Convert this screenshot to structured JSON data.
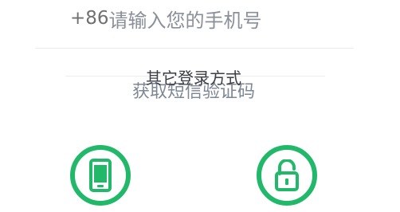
{
  "phone": {
    "country_code": "+86",
    "placeholder": "请输入您的手机号"
  },
  "other_login": {
    "label": "其它登录方式"
  },
  "sms_code": {
    "label": "获取短信验证码"
  },
  "options": [
    {
      "icon": "mobile-phone-icon"
    },
    {
      "icon": "unlock-icon"
    }
  ],
  "colors": {
    "accent": "#22b86a",
    "placeholder": "#8a8f99",
    "link": "#7d8796",
    "divider": "#ececec"
  }
}
